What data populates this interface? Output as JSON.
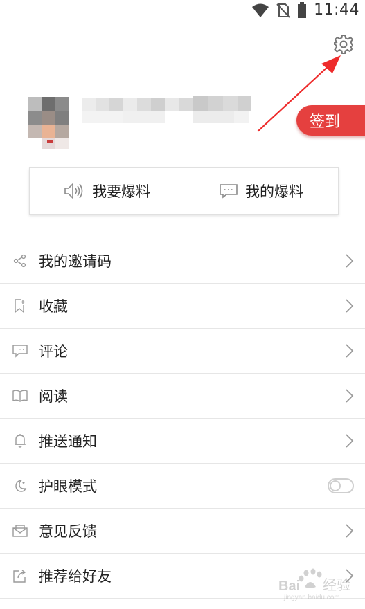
{
  "status_bar": {
    "time": "11:44",
    "icons": [
      "wifi-icon",
      "no-sim-icon",
      "battery-icon"
    ]
  },
  "header": {
    "settings_icon": "gear-icon",
    "signin_label": "签到",
    "accent_color": "#e5403f"
  },
  "tips": [
    {
      "label": "我要爆料",
      "icon": "speaker-icon"
    },
    {
      "label": "我的爆料",
      "icon": "chat-box-icon"
    }
  ],
  "menu": {
    "items": [
      {
        "label": "我的邀请码",
        "icon": "share-icon",
        "trailing": "chevron"
      },
      {
        "label": "收藏",
        "icon": "bookmark-icon",
        "trailing": "chevron"
      },
      {
        "label": "评论",
        "icon": "comment-icon",
        "trailing": "chevron"
      },
      {
        "label": "阅读",
        "icon": "book-icon",
        "trailing": "chevron"
      },
      {
        "label": "推送通知",
        "icon": "bell-icon",
        "trailing": "chevron"
      },
      {
        "label": "护眼模式",
        "icon": "moon-icon",
        "trailing": "toggle",
        "toggle_on": false
      },
      {
        "label": "意见反馈",
        "icon": "mail-icon",
        "trailing": "chevron"
      },
      {
        "label": "推荐给好友",
        "icon": "recommend-share-icon",
        "trailing": "chevron"
      }
    ]
  },
  "watermark": {
    "text": "Baidu 经验",
    "url": "jingyan.baidu.com"
  }
}
